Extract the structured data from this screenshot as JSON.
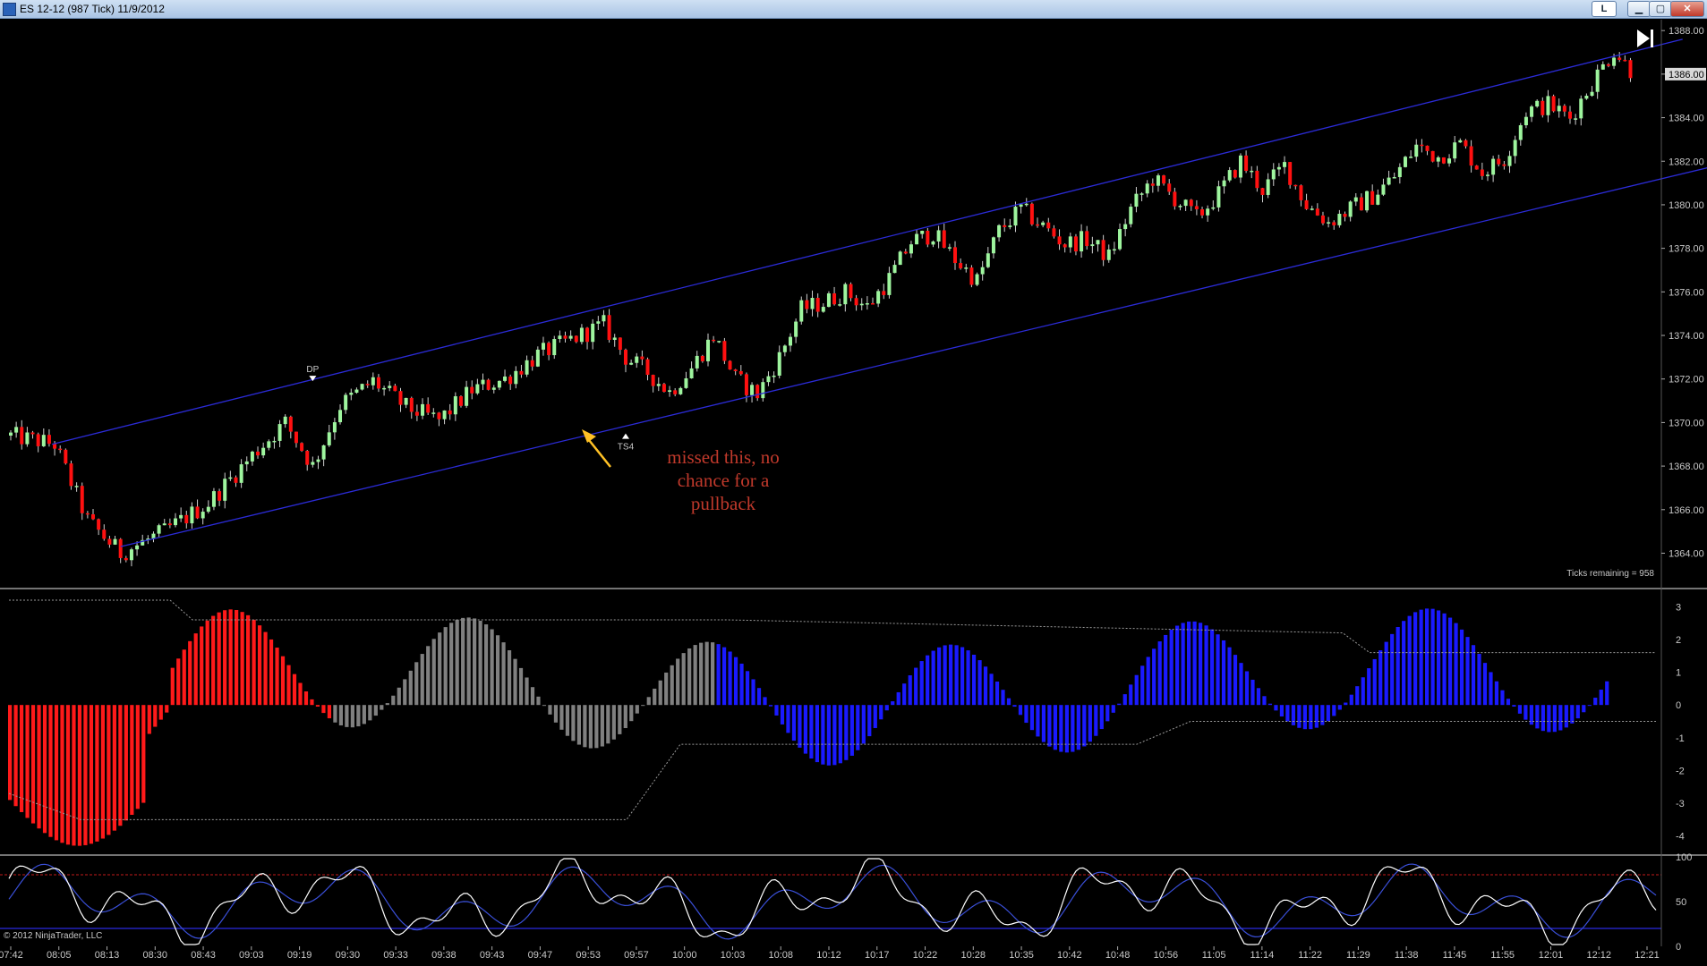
{
  "window": {
    "title": "ES 12-12 (987 Tick)  11/9/2012",
    "buttons": {
      "layout_label": "L",
      "minimize": "▁",
      "maximize": "▢",
      "close": "✕"
    }
  },
  "chart_data": [
    {
      "type": "candlestick",
      "title": "ES 12-12 (987 Tick)  11/9/2012",
      "ylim": [
        1362.5,
        1388.5
      ],
      "y_ticks": [
        "1388.00",
        "1386.00",
        "1384.00",
        "1382.00",
        "1380.00",
        "1378.00",
        "1376.00",
        "1374.00",
        "1372.00",
        "1370.00",
        "1368.00",
        "1366.00",
        "1364.00"
      ],
      "y_tick_values": [
        1388,
        1386,
        1384,
        1382,
        1380,
        1378,
        1376,
        1374,
        1372,
        1370,
        1368,
        1366,
        1364
      ],
      "current_price": "1386.00",
      "x_tick_labels": [
        "07:42",
        "08:05",
        "08:13",
        "08:30",
        "08:43",
        "09:03",
        "09:19",
        "09:30",
        "09:33",
        "09:38",
        "09:43",
        "09:47",
        "09:53",
        "09:57",
        "10:00",
        "10:03",
        "10:08",
        "10:12",
        "10:17",
        "10:22",
        "10:28",
        "10:35",
        "10:42",
        "10:48",
        "10:56",
        "11:05",
        "11:14",
        "11:22",
        "11:29",
        "11:38",
        "11:45",
        "11:55",
        "12:01",
        "12:12",
        "12:21"
      ],
      "close_path": [
        [
          0,
          1369.4
        ],
        [
          8,
          1369.0
        ],
        [
          14,
          1365.5
        ],
        [
          20,
          1364.0
        ],
        [
          28,
          1365.0
        ],
        [
          36,
          1366.3
        ],
        [
          44,
          1368.5
        ],
        [
          50,
          1370.0
        ],
        [
          55,
          1368.0
        ],
        [
          60,
          1370.8
        ],
        [
          66,
          1371.9
        ],
        [
          72,
          1370.7
        ],
        [
          78,
          1370.1
        ],
        [
          84,
          1371.5
        ],
        [
          90,
          1372.0
        ],
        [
          96,
          1373.1
        ],
        [
          102,
          1373.8
        ],
        [
          108,
          1374.5
        ],
        [
          112,
          1373.0
        ],
        [
          116,
          1372.3
        ],
        [
          120,
          1371.4
        ],
        [
          124,
          1372.5
        ],
        [
          128,
          1374.0
        ],
        [
          132,
          1372.0
        ],
        [
          136,
          1371.3
        ],
        [
          140,
          1373.0
        ],
        [
          144,
          1375.2
        ],
        [
          148,
          1375.5
        ],
        [
          152,
          1376.0
        ],
        [
          156,
          1375.3
        ],
        [
          160,
          1376.6
        ],
        [
          164,
          1378.3
        ],
        [
          168,
          1378.7
        ],
        [
          172,
          1377.5
        ],
        [
          176,
          1376.5
        ],
        [
          180,
          1378.8
        ],
        [
          184,
          1379.8
        ],
        [
          188,
          1379.0
        ],
        [
          192,
          1378.2
        ],
        [
          196,
          1378.4
        ],
        [
          200,
          1377.6
        ],
        [
          204,
          1379.8
        ],
        [
          208,
          1381.2
        ],
        [
          212,
          1380.3
        ],
        [
          216,
          1379.4
        ],
        [
          220,
          1380.5
        ],
        [
          224,
          1382.0
        ],
        [
          228,
          1380.7
        ],
        [
          232,
          1381.8
        ],
        [
          236,
          1380.0
        ],
        [
          240,
          1379.2
        ],
        [
          244,
          1379.8
        ],
        [
          248,
          1380.4
        ],
        [
          252,
          1381.3
        ],
        [
          256,
          1382.7
        ],
        [
          260,
          1382.2
        ],
        [
          264,
          1382.8
        ],
        [
          268,
          1381.5
        ],
        [
          272,
          1382.1
        ],
        [
          276,
          1384.3
        ],
        [
          280,
          1384.6
        ],
        [
          284,
          1384.0
        ],
        [
          288,
          1385.6
        ],
        [
          292,
          1387.1
        ],
        [
          295,
          1386.2
        ]
      ],
      "channel": {
        "upper": [
          [
            7.5,
            1369.0
          ],
          [
            304.5,
            1387.6
          ]
        ],
        "lower": [
          [
            20,
            1364.3
          ],
          [
            324,
            1382.6
          ]
        ]
      },
      "markers": [
        {
          "label": "DP",
          "x": 55,
          "price": 1371.9
        },
        {
          "label": "TS4",
          "x": 112,
          "price": 1369.5
        }
      ],
      "annotation": "missed this, no chance for a pullback",
      "annotation_lines": [
        "missed this, no",
        "chance for a",
        "pullback"
      ],
      "ticks_remaining": "Ticks remaining = 958",
      "copyright": "© 2012 NinjaTrader, LLC"
    },
    {
      "type": "histogram",
      "ylim": [
        -4.5,
        3.5
      ],
      "y_tick_values": [
        3,
        2,
        1,
        0,
        -1,
        -2,
        -3,
        -4
      ],
      "y_ticks": [
        "3",
        "2",
        "1",
        "0",
        "-1",
        "-2",
        "-3",
        "-4"
      ],
      "series_colors": {
        "bearish": "#ff1a1a",
        "neutral": "#808080",
        "bullish": "#1a1aff"
      }
    },
    {
      "type": "line",
      "ylim": [
        0,
        100
      ],
      "y_tick_values": [
        100,
        50,
        0
      ],
      "y_ticks": [
        "100",
        "50",
        "0"
      ],
      "levels": {
        "overbought": 80,
        "oversold": 20
      }
    }
  ]
}
